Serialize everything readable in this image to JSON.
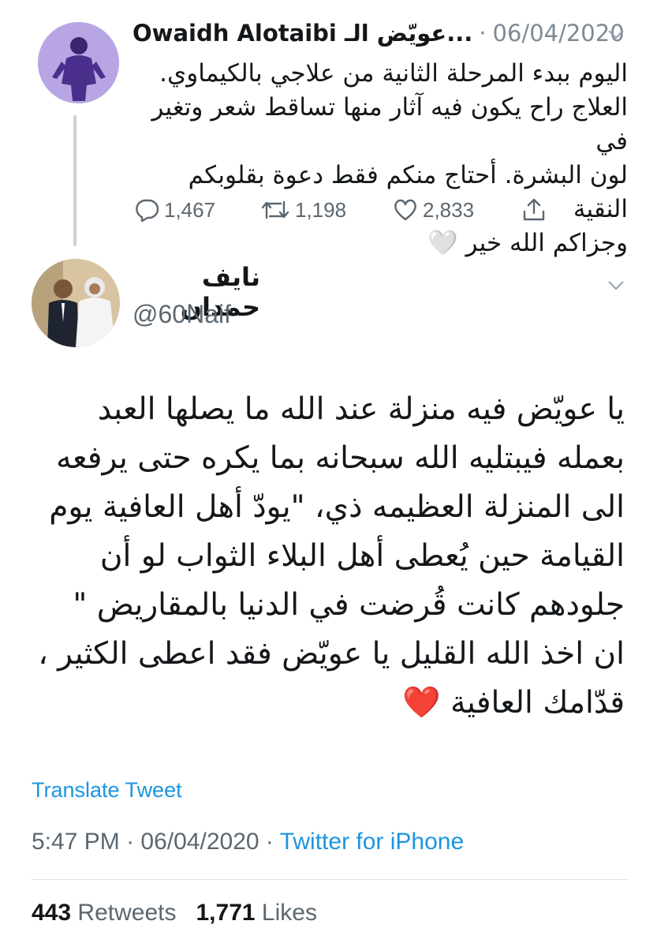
{
  "original_tweet": {
    "display_name": "Owaidh Alotaibi عويّض الـ...",
    "date": "06/04/2020",
    "separator": "·",
    "body_lines": [
      "اليوم ببدء المرحلة الثانية من علاجي بالكيماوي.",
      "العلاج راح يكون فيه آثار منها تساقط شعر وتغير في",
      "لون البشرة. أحتاج منكم فقط دعوة بقلوبكم النقية",
      "وجزاكم الله خير 🤍"
    ],
    "replies": "1,467",
    "retweets": "1,198",
    "likes": "2,833"
  },
  "reply_tweet": {
    "display_name": "نايف حمدان",
    "handle": "@60Naif",
    "body_lines": [
      "يا عويّض فيه منزلة عند الله ما يصلها العبد",
      "بعمله فيبتليه الله سبحانه بما يكره حتى يرفعه",
      "الى المنزلة العظيمه ذي، \"يودّ أهل العافية يوم",
      "القيامة حين يُعطى أهل البلاء الثواب لو أن",
      "جلودهم كانت قُرضت في الدنيا بالمقاريض \"",
      "ان اخذ الله القليل يا عويّض فقد اعطى الكثير ،",
      "قدّامك العافية ❤️"
    ],
    "translate_label": "Translate Tweet",
    "time": "5:47 PM",
    "date": "06/04/2020",
    "separator": "·",
    "source": "Twitter for iPhone",
    "retweets_count": "443",
    "retweets_label": "Retweets",
    "likes_count": "1,771",
    "likes_label": "Likes"
  },
  "icons": [
    "chevron-down-icon",
    "reply-icon",
    "retweet-icon",
    "like-icon",
    "share-icon"
  ],
  "colors": {
    "link": "#1b95e0",
    "secondary_text": "#5b6770",
    "thread_line": "#c9d2db"
  }
}
